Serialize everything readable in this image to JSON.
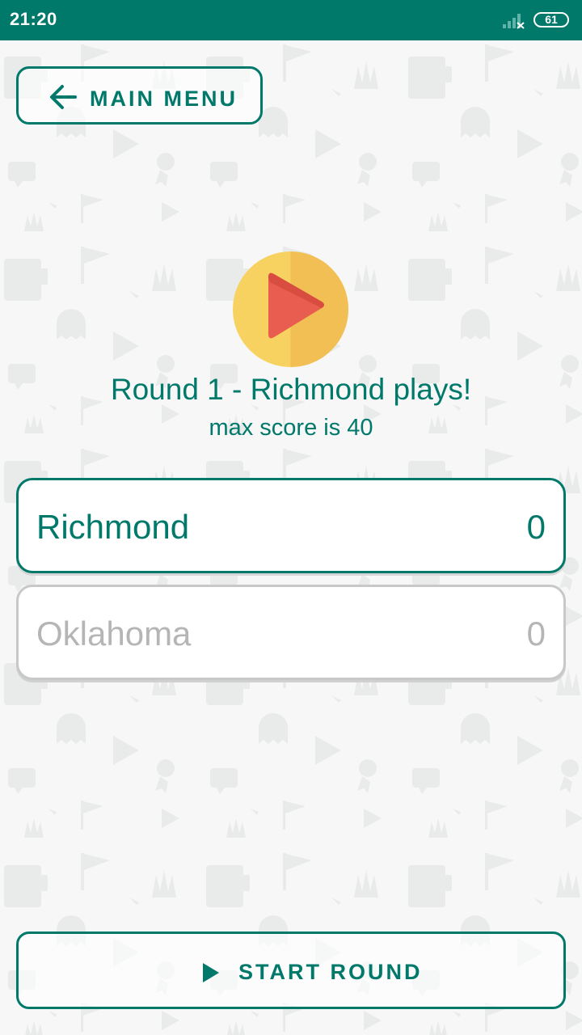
{
  "status_bar": {
    "time": "21:20",
    "battery": "61",
    "icons": [
      "signal-icon",
      "battery-icon"
    ],
    "background_color": "#00796b"
  },
  "nav": {
    "main_menu_label": "MAIN MENU",
    "icon": "arrow-left-icon"
  },
  "round": {
    "icon": "play-circle-icon",
    "title": "Round 1 - Richmond plays!",
    "subtitle": "max score is 40"
  },
  "teams": [
    {
      "name": "Richmond",
      "score": "0",
      "active": true
    },
    {
      "name": "Oklahoma",
      "score": "0",
      "active": false
    }
  ],
  "actions": {
    "start_round_label": "START ROUND",
    "icon": "play-icon"
  },
  "colors": {
    "accent": "#00796b",
    "background": "#f7f7f7",
    "inactive_text": "#b5b5b5",
    "play_circle_yellow": "#f8d260",
    "play_triangle_red": "#e85d4f"
  }
}
